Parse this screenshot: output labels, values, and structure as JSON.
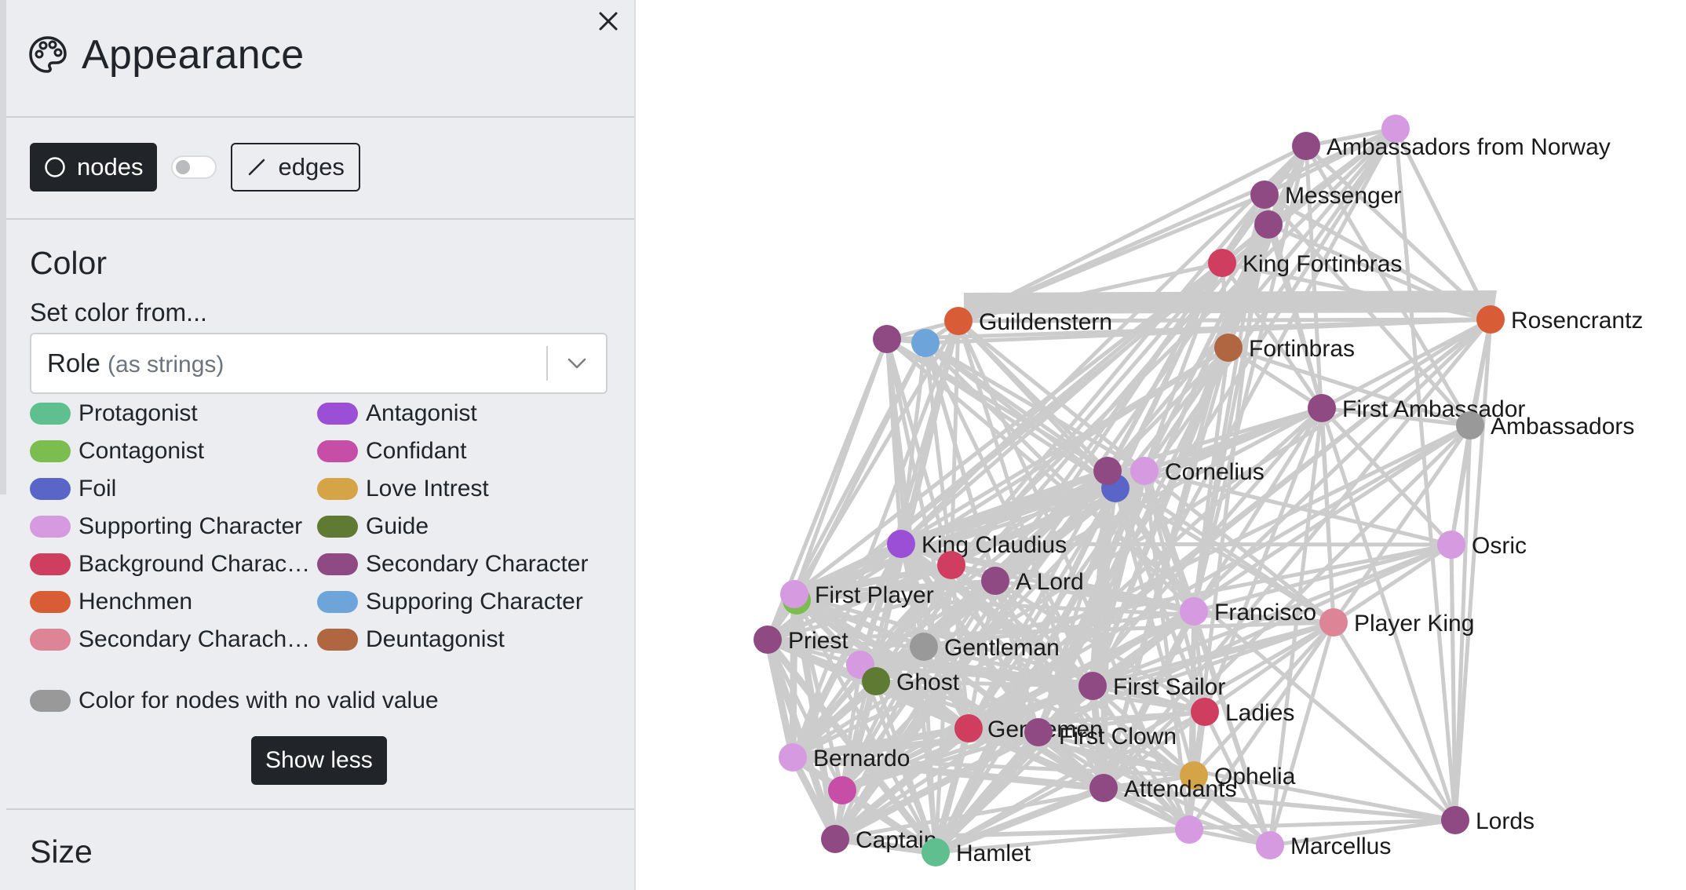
{
  "panel": {
    "title": "Appearance",
    "icons": {
      "title_icon": "palette-icon",
      "close_icon": "close-icon",
      "nodes_icon": "circle-icon",
      "edges_icon": "line-icon",
      "dropdown_icon": "chevron-down-icon"
    },
    "toggle": {
      "nodes_label": "nodes",
      "edges_label": "edges",
      "active": "nodes"
    },
    "color": {
      "section_title": "Color",
      "set_from_label": "Set color from...",
      "select_value": "Role",
      "select_hint": "(as strings)",
      "legend": [
        {
          "label": "Protagonist",
          "color": "#5fbf8f"
        },
        {
          "label": "Antagonist",
          "color": "#9b4fd6"
        },
        {
          "label": "Contagonist",
          "color": "#7cbd4f"
        },
        {
          "label": "Confidant",
          "color": "#c74ea6"
        },
        {
          "label": "Foil",
          "color": "#5a66c7"
        },
        {
          "label": "Love Intrest",
          "color": "#d5a446"
        },
        {
          "label": "Supporting Character",
          "color": "#d59ae0"
        },
        {
          "label": "Guide",
          "color": "#5f7a33"
        },
        {
          "label": "Background Charac…",
          "color": "#cf3d5f"
        },
        {
          "label": "Secondary Character",
          "color": "#8f4a83"
        },
        {
          "label": "Henchmen",
          "color": "#d85c36"
        },
        {
          "label": "Supporing Character",
          "color": "#6da5db"
        },
        {
          "label": "Secondary Charach…",
          "color": "#dd8497"
        },
        {
          "label": "Deuntagonist",
          "color": "#b06641"
        }
      ],
      "no_value_label": "Color for nodes with no valid value",
      "no_value_color": "#999999",
      "show_less_label": "Show less"
    },
    "size": {
      "section_title": "Size"
    }
  },
  "graph": {
    "edge_color": "#cccccc",
    "nodes": [
      {
        "label": "Ambassadors from Norway",
        "role": "Secondary Character",
        "color": "#8f4a83"
      },
      {
        "label": "",
        "role": "Supporting Character",
        "color": "#d59ae0"
      },
      {
        "label": "Messenger",
        "role": "Secondary Character",
        "color": "#8f4a83"
      },
      {
        "label": "",
        "role": "Secondary Character",
        "color": "#8f4a83"
      },
      {
        "label": "King Fortinbras",
        "role": "Background Character",
        "color": "#cf3d5f"
      },
      {
        "label": "Guildenstern",
        "role": "Henchmen",
        "color": "#d85c36"
      },
      {
        "label": "",
        "role": "Supporing Character",
        "color": "#6da5db"
      },
      {
        "label": "",
        "role": "Secondary Character",
        "color": "#8f4a83"
      },
      {
        "label": "Rosencrantz",
        "role": "Henchmen",
        "color": "#d85c36"
      },
      {
        "label": "Fortinbras",
        "role": "Deuntagonist",
        "color": "#b06641"
      },
      {
        "label": "First Ambassador",
        "role": "Secondary Character",
        "color": "#8f4a83"
      },
      {
        "label": "Ambassadors",
        "role": "none",
        "color": "#999999"
      },
      {
        "label": "Cornelius",
        "role": "Supporting Character",
        "color": "#d59ae0"
      },
      {
        "label": "",
        "role": "Foil",
        "color": "#5a66c7"
      },
      {
        "label": "",
        "role": "Secondary Character",
        "color": "#8f4a83"
      },
      {
        "label": "King Claudius",
        "role": "Antagonist",
        "color": "#9b4fd6"
      },
      {
        "label": "",
        "role": "Background Character",
        "color": "#cf3d5f"
      },
      {
        "label": "A Lord",
        "role": "Secondary Character",
        "color": "#8f4a83"
      },
      {
        "label": "Osric",
        "role": "Supporting Character",
        "color": "#d59ae0"
      },
      {
        "label": "",
        "role": "Contagonist",
        "color": "#7cbd4f"
      },
      {
        "label": "First Player",
        "role": "Supporting Character",
        "color": "#d59ae0"
      },
      {
        "label": "Francisco",
        "role": "Supporting Character",
        "color": "#d59ae0"
      },
      {
        "label": "Player King",
        "role": "Secondary Charach…",
        "color": "#dd8497"
      },
      {
        "label": "Priest",
        "role": "Secondary Character",
        "color": "#8f4a83"
      },
      {
        "label": "Gentleman",
        "role": "none",
        "color": "#999999"
      },
      {
        "label": "",
        "role": "Supporting Character",
        "color": "#d59ae0"
      },
      {
        "label": "Ghost",
        "role": "Guide",
        "color": "#5f7a33"
      },
      {
        "label": "First Sailor",
        "role": "Secondary Character",
        "color": "#8f4a83"
      },
      {
        "label": "Ladies",
        "role": "Background Character",
        "color": "#cf3d5f"
      },
      {
        "label": "Gentlemen",
        "role": "Background Character",
        "color": "#cf3d5f"
      },
      {
        "label": "First Clown",
        "role": "Secondary Character",
        "color": "#8f4a83"
      },
      {
        "label": "Bernardo",
        "role": "Supporting Character",
        "color": "#d59ae0"
      },
      {
        "label": "Ophelia",
        "role": "Love Intrest",
        "color": "#d5a446"
      },
      {
        "label": "",
        "role": "Confidant",
        "color": "#c74ea6"
      },
      {
        "label": "Attendants",
        "role": "Secondary Character",
        "color": "#8f4a83"
      },
      {
        "label": "Lords",
        "role": "Secondary Character",
        "color": "#8f4a83"
      },
      {
        "label": "",
        "role": "Supporting Character",
        "color": "#d59ae0"
      },
      {
        "label": "Captain",
        "role": "Secondary Character",
        "color": "#8f4a83"
      },
      {
        "label": "Hamlet",
        "role": "Protagonist",
        "color": "#5fbf8f"
      },
      {
        "label": "Marcellus",
        "role": "Supporting Character",
        "color": "#d59ae0"
      }
    ]
  }
}
